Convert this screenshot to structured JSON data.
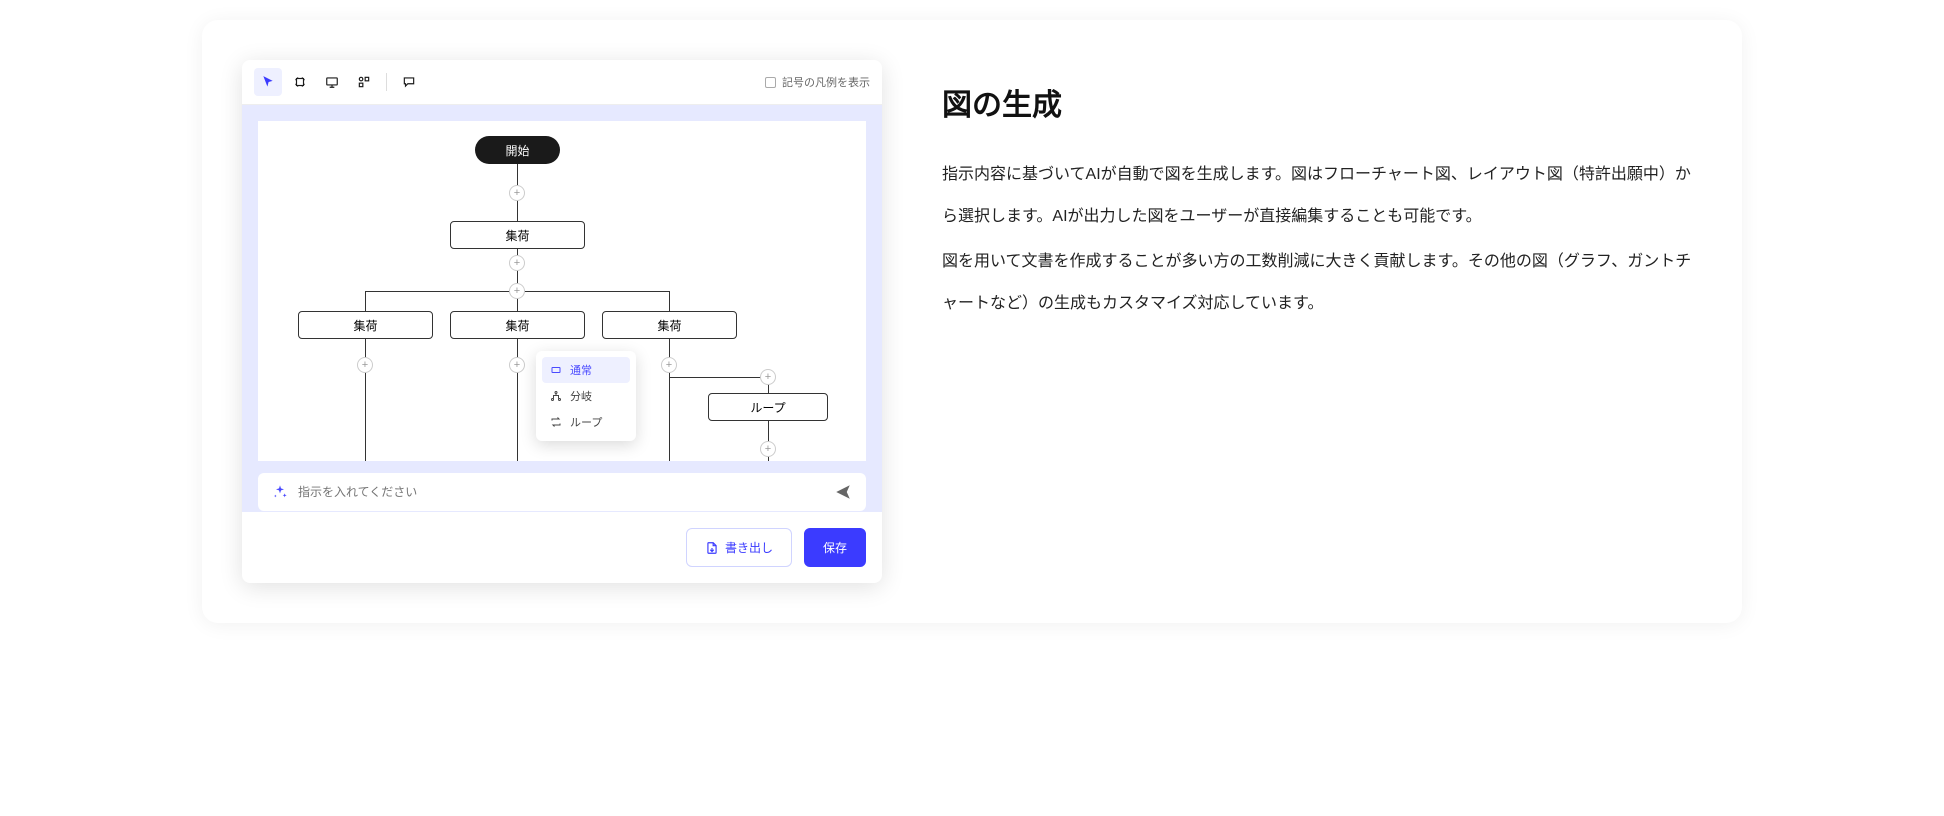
{
  "headline": "図の生成",
  "description": {
    "p1": "指示内容に基づいてAIが自動で図を生成します。図はフローチャート図、レイアウト図（特許出願中）から選択します。AIが出力した図をユーザーが直接編集することも可能です。",
    "p2": "図を用いて文書を作成することが多い方の工数削減に大きく貢献します。その他の図（グラフ、ガントチャートなど）の生成もカスタマイズ対応しています。"
  },
  "toolbar": {
    "legend_label": "記号の凡例を表示"
  },
  "nodes": {
    "start": "開始",
    "box1": "集荷",
    "box2a": "集荷",
    "box2b": "集荷",
    "box2c": "集荷",
    "loop": "ループ"
  },
  "ctx": {
    "normal": "通常",
    "branch": "分岐",
    "loop": "ループ"
  },
  "prompt": {
    "placeholder": "指示を入れてください"
  },
  "buttons": {
    "export": "書き出し",
    "save": "保存"
  }
}
